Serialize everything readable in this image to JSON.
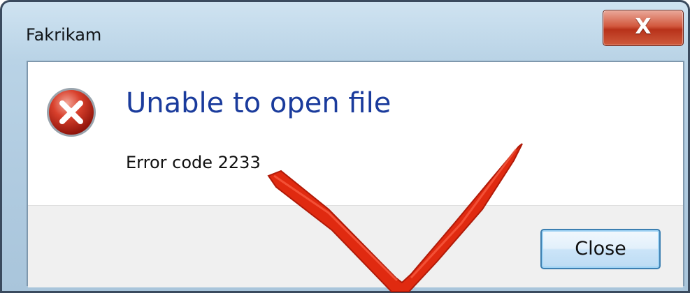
{
  "window": {
    "title": "Fakrikam",
    "close_glyph": "X"
  },
  "dialog": {
    "icon": "error-icon",
    "heading": "Unable to open file",
    "detail": "Error code 2233",
    "close_label": "Close"
  },
  "colors": {
    "heading": "#1a3b9c",
    "check_mark": "#e02a10",
    "error_icon": "#c8261a"
  },
  "annotation": {
    "icon": "checkmark-icon"
  }
}
